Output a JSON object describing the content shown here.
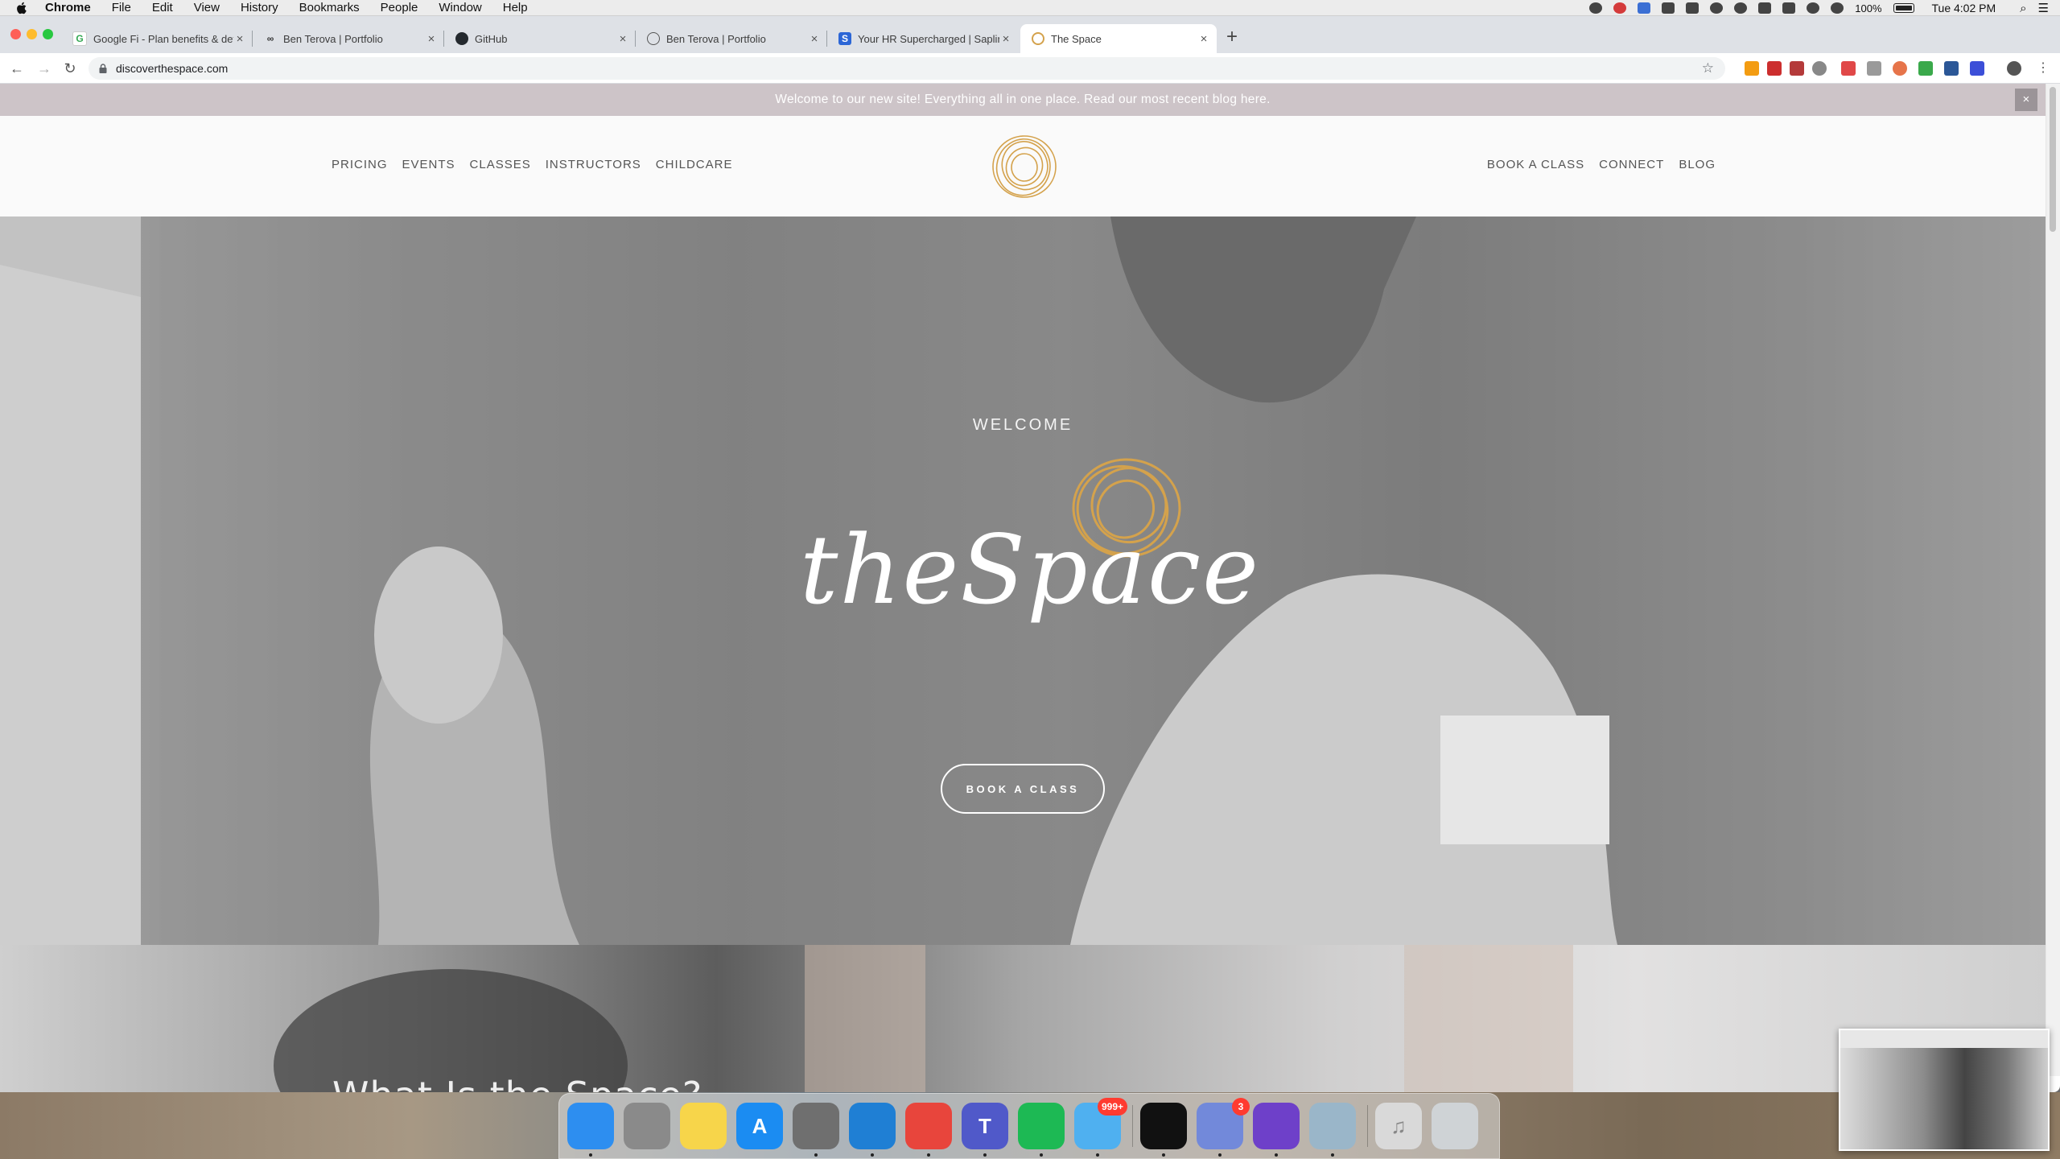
{
  "menubar": {
    "app_name": "Chrome",
    "items": [
      "File",
      "Edit",
      "View",
      "History",
      "Bookmarks",
      "People",
      "Window",
      "Help"
    ],
    "battery_text": "100%",
    "clock": "Tue 4:02 PM"
  },
  "browser": {
    "tabs": [
      {
        "title": "Google Fi - Plan benefits & det",
        "favicon": "google-fi-icon",
        "active": false
      },
      {
        "title": "Ben Terova | Portfolio",
        "favicon": "infinity-icon",
        "active": false
      },
      {
        "title": "GitHub",
        "favicon": "github-icon",
        "active": false
      },
      {
        "title": "Ben Terova | Portfolio",
        "favicon": "globe-icon",
        "active": false
      },
      {
        "title": "Your HR Supercharged | Saplin",
        "favicon": "sapling-icon",
        "active": false
      },
      {
        "title": "The Space",
        "favicon": "the-space-icon",
        "active": true
      }
    ],
    "new_tab": "+",
    "url": "discoverthespace.com"
  },
  "site": {
    "announcement": "Welcome to our new site! Everything all in one place. Read our most recent blog here.",
    "announcement_close": "×",
    "nav_left": [
      "PRICING",
      "EVENTS",
      "CLASSES",
      "INSTRUCTORS",
      "CHILDCARE"
    ],
    "nav_right": [
      "BOOK A CLASS",
      "CONNECT",
      "BLOG"
    ],
    "hero": {
      "kicker": "WELCOME",
      "logo_text": "theSpace",
      "cta": "BOOK A CLASS"
    },
    "section_title": "What Is the Space?",
    "colors": {
      "gold": "#d4a24c",
      "banner": "#cdc4c8"
    }
  },
  "dock": {
    "apps": [
      {
        "name": "Finder",
        "icon": "finder-icon",
        "color": "#2d8ef0",
        "label": ""
      },
      {
        "name": "Launchpad",
        "icon": "rocket-icon",
        "color": "#8a8a8a",
        "label": ""
      },
      {
        "name": "Notes",
        "icon": "notes-icon",
        "color": "#f7d54a",
        "label": ""
      },
      {
        "name": "App Store",
        "icon": "app-store-icon",
        "color": "#1b8cf2",
        "label": "A"
      },
      {
        "name": "System Preferences",
        "icon": "gear-icon",
        "color": "#6f6f6f",
        "label": ""
      },
      {
        "name": "Visual Studio Code",
        "icon": "vscode-icon",
        "color": "#1f7fd4",
        "label": ""
      },
      {
        "name": "Chrome",
        "icon": "chrome-icon",
        "color": "#e8453c",
        "label": ""
      },
      {
        "name": "Teams",
        "icon": "teams-icon",
        "color": "#5059c9",
        "label": "T"
      },
      {
        "name": "Spotify",
        "icon": "spotify-icon",
        "color": "#1db954",
        "label": ""
      },
      {
        "name": "Mail",
        "icon": "mail-icon",
        "color": "#4fb0f0",
        "label": "",
        "badge": "999+"
      },
      {
        "name": "Sapling",
        "icon": "sapling-dock-icon",
        "color": "#111",
        "label": ""
      },
      {
        "name": "Discord",
        "icon": "discord-icon",
        "color": "#7289da",
        "label": "",
        "badge": "3"
      },
      {
        "name": "GitHub Desktop",
        "icon": "github-desktop-icon",
        "color": "#6e40c9",
        "label": ""
      },
      {
        "name": "Preview",
        "icon": "preview-icon",
        "color": "#9ab6c9",
        "label": ""
      },
      {
        "name": "Music",
        "icon": "music-icon",
        "color": "#d9d9d9",
        "label": "♫"
      },
      {
        "name": "Trash",
        "icon": "trash-icon",
        "color": "#cfd3d6",
        "label": ""
      }
    ]
  }
}
